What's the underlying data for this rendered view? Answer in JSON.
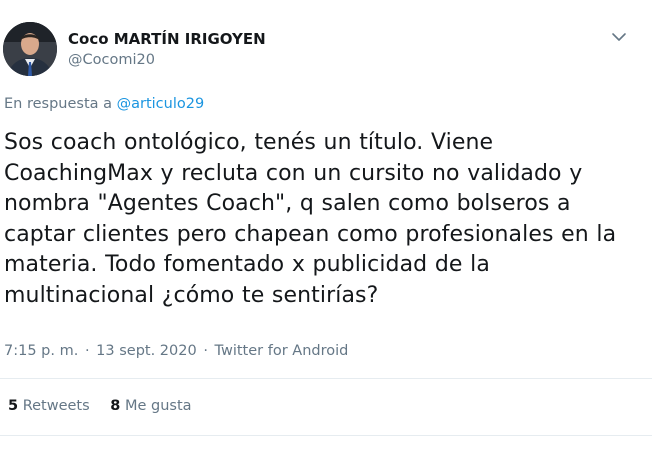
{
  "author": {
    "display_name": "Coco MARTÍN IRIGOYEN",
    "handle": "@Cocomi20"
  },
  "reply": {
    "prefix": "En respuesta a",
    "mention": "@articulo29"
  },
  "tweet": {
    "lines": [
      "Sos coach ontológico, tenés un título. Viene",
      "CoachingMax y recluta con un cursito no validado y",
      "nombra \"Agentes Coach\", q salen como bolseros a",
      "captar clientes pero chapean como profesionales en la",
      "materia. Todo fomentado x publicidad de la",
      "multinacional ¿cómo te sentirías?"
    ]
  },
  "meta": {
    "time": "7:15 p. m.",
    "separator": "·",
    "date": "13 sept. 2020",
    "source": "Twitter for Android"
  },
  "stats": {
    "retweets_count": "5",
    "retweets_label": "Retweets",
    "likes_count": "8",
    "likes_label": "Me gusta"
  },
  "icons": {
    "menu": "chevron-down-icon"
  },
  "colors": {
    "text": "#14171a",
    "secondary": "#657786",
    "link": "#1b95e0",
    "divider": "#e6ecf0"
  }
}
